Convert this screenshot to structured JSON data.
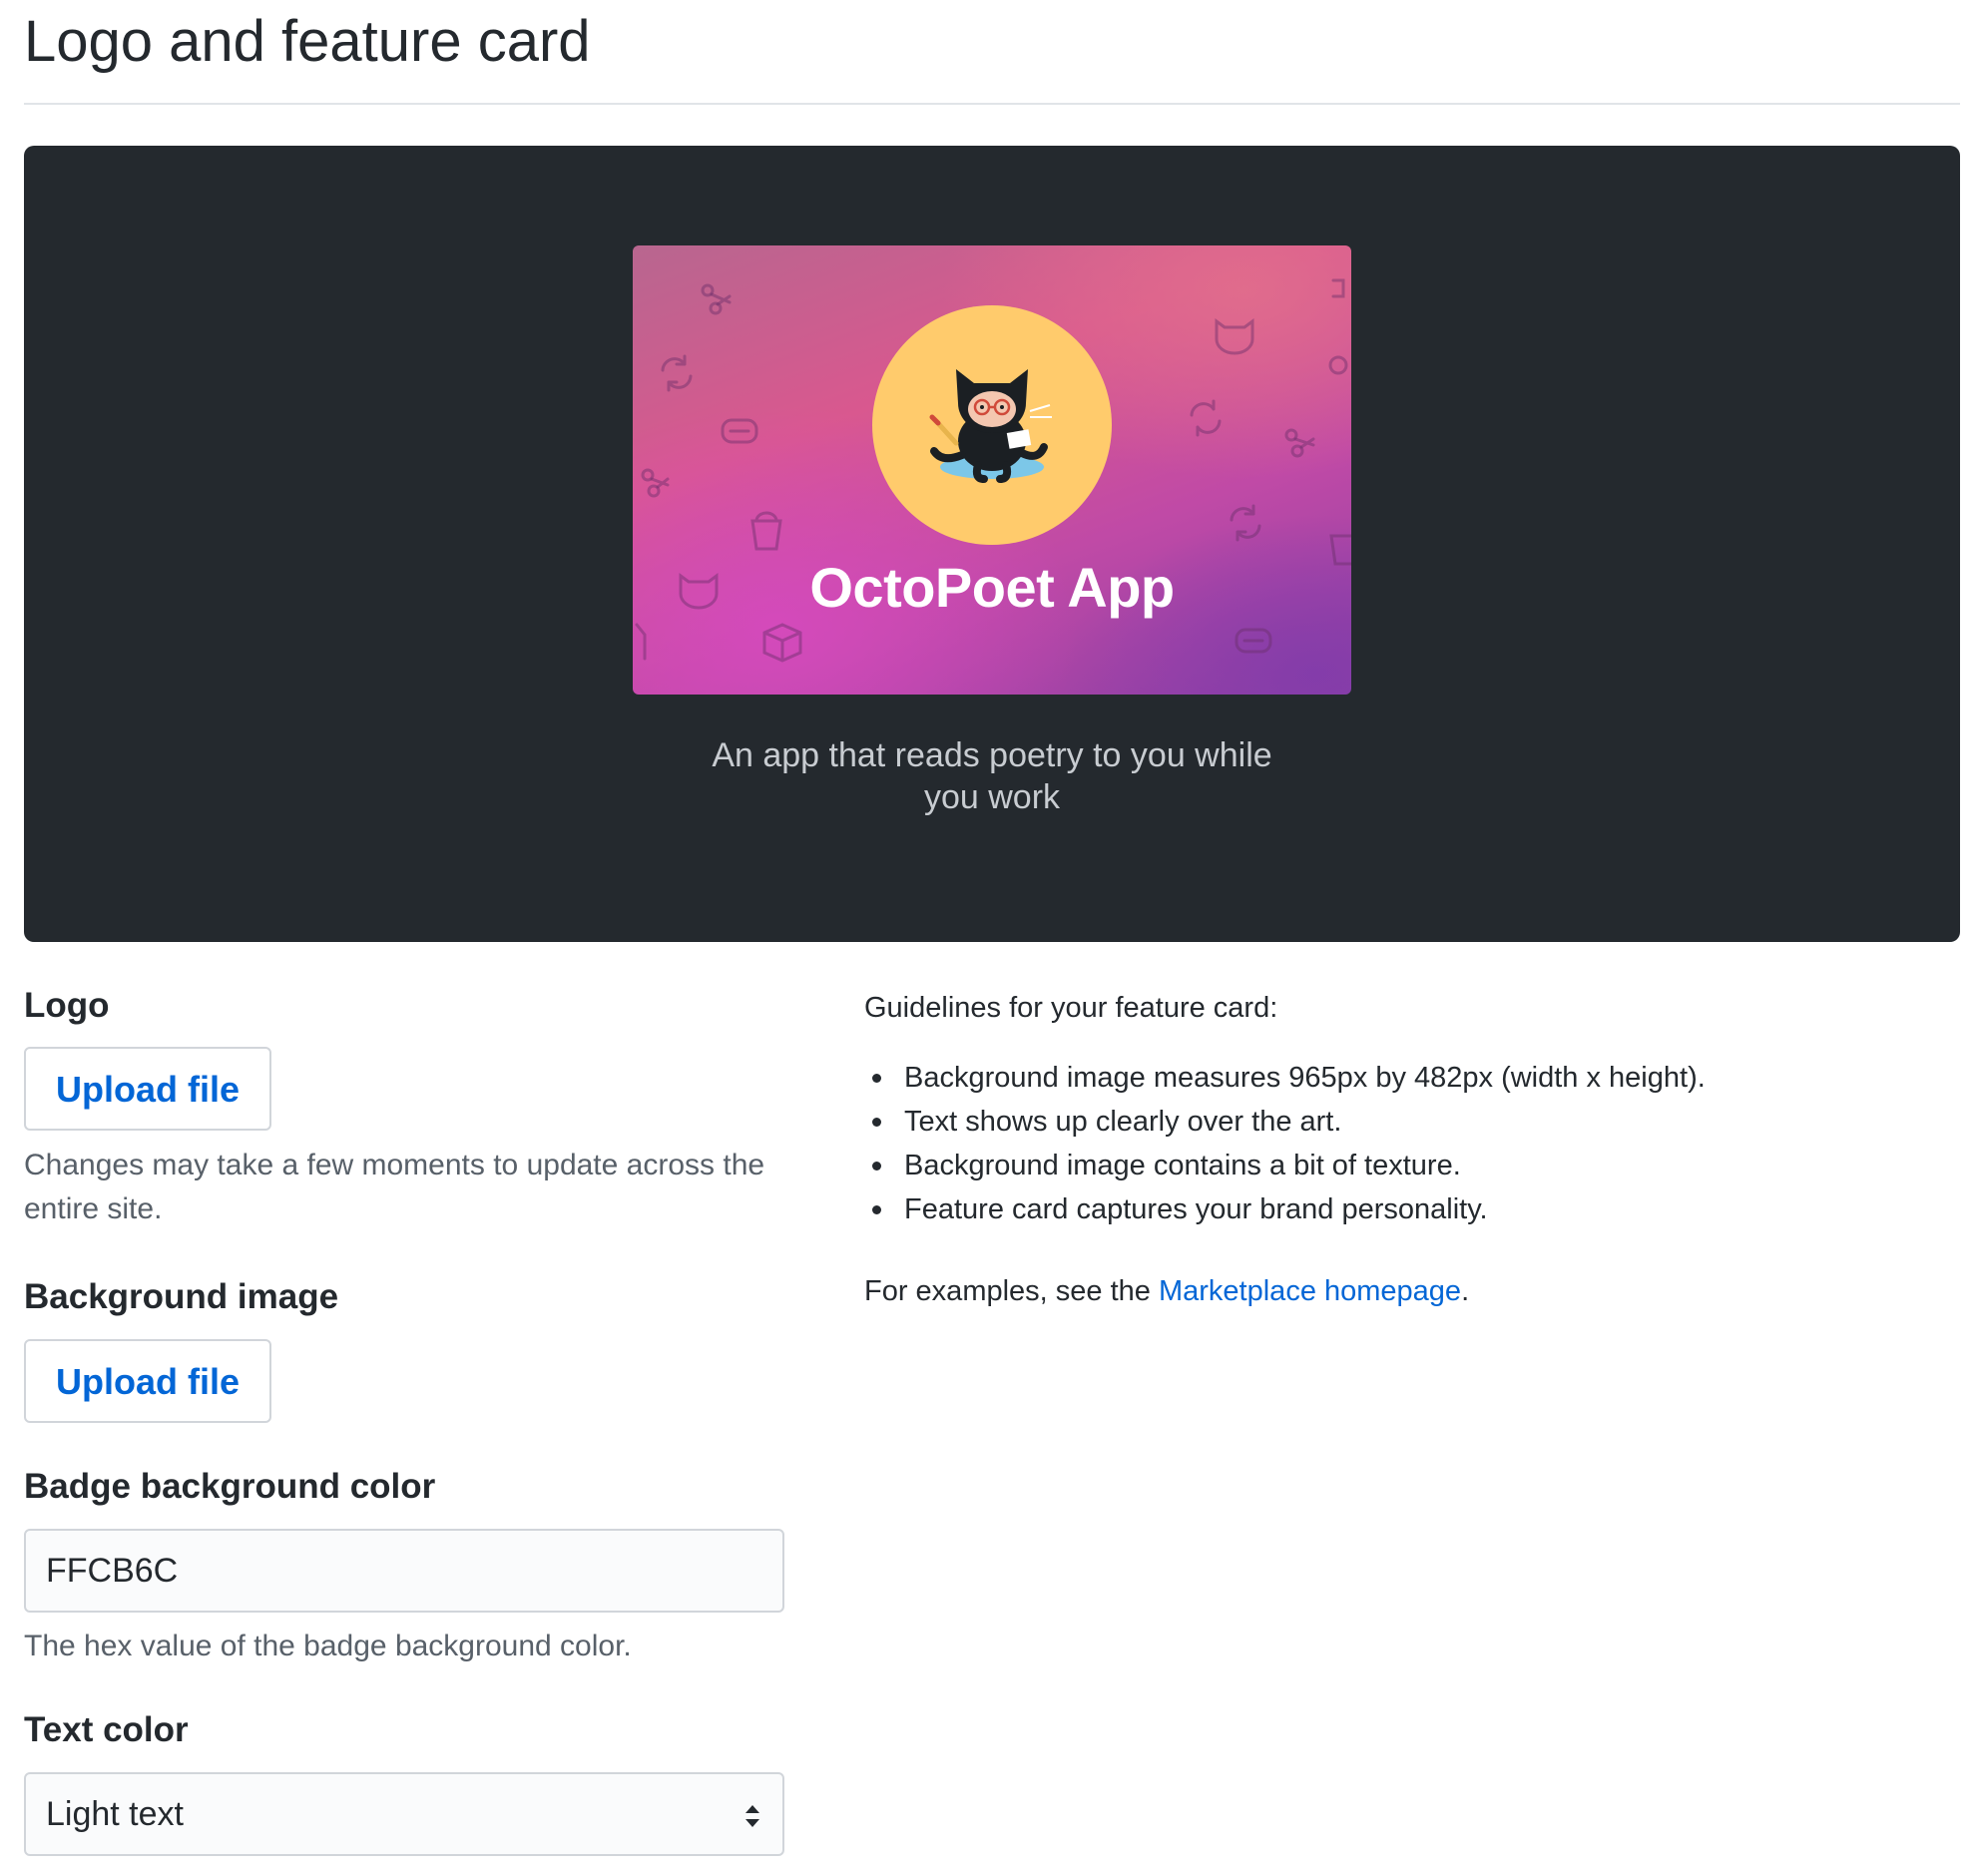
{
  "page": {
    "title": "Logo and feature card"
  },
  "preview": {
    "app_name": "OctoPoet App",
    "description": "An app that reads poetry to you while you work"
  },
  "logo": {
    "label": "Logo",
    "upload_label": "Upload file",
    "help": "Changes may take a few moments to update across the entire site."
  },
  "background_image": {
    "label": "Background image",
    "upload_label": "Upload file"
  },
  "badge_color": {
    "label": "Badge background color",
    "value": "FFCB6C",
    "help": "The hex value of the badge background color."
  },
  "text_color": {
    "label": "Text color",
    "selected": "Light text"
  },
  "guidelines": {
    "title": "Guidelines for your feature card:",
    "items": [
      "Background image measures 965px by 482px (width x height).",
      "Text shows up clearly over the art.",
      "Background image contains a bit of texture.",
      "Feature card captures your brand personality."
    ],
    "examples_prefix": "For examples, see the ",
    "examples_link": "Marketplace homepage",
    "examples_suffix": "."
  },
  "colors": {
    "preview_bg": "#24292e",
    "badge_bg": "#FFCB6C",
    "link": "#0366d6"
  }
}
